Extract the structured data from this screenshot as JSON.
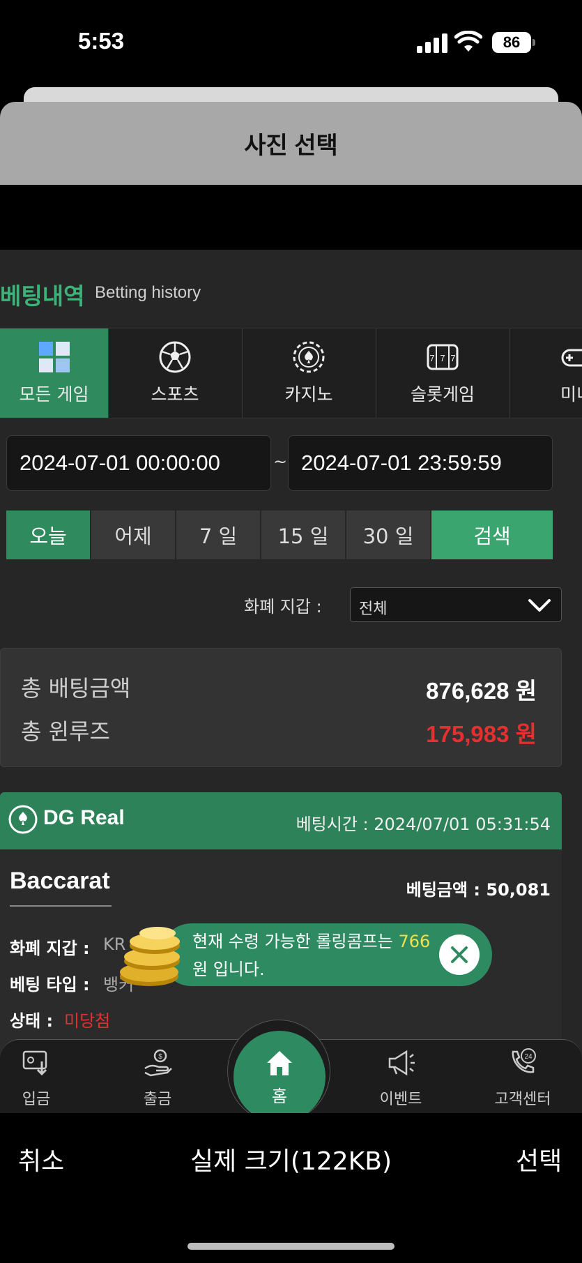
{
  "status_bar": {
    "time": "5:53",
    "battery": "86"
  },
  "sheet": {
    "title": "사진 선택"
  },
  "section": {
    "title": "베팅내역",
    "subtitle": "Betting history"
  },
  "tabs": [
    {
      "label": "모든 게임",
      "icon": "grid-cubes-icon",
      "active": true
    },
    {
      "label": "스포츠",
      "icon": "soccer-ball-icon",
      "active": false
    },
    {
      "label": "카지노",
      "icon": "poker-chip-icon",
      "active": false
    },
    {
      "label": "슬롯게임",
      "icon": "slot-777-icon",
      "active": false
    },
    {
      "label": "미니",
      "icon": "gamepad-icon",
      "active": false
    }
  ],
  "filters": {
    "date_from": "2024-07-01 00:00:00",
    "date_to": "2024-07-01 23:59:59",
    "separator": "~",
    "quick": [
      "오늘",
      "어제",
      "7 일",
      "15 일",
      "30 일"
    ],
    "quick_active": "오늘",
    "search": "검색",
    "wallet_label": "화폐 지갑 :",
    "wallet_value": "전체"
  },
  "summary": {
    "total_bet_label": "총 배팅금액",
    "total_bet_value": "876,628 원",
    "total_winloss_label": "총 윈루즈",
    "total_winloss_value": "175,983 원"
  },
  "card": {
    "provider": "DG Real",
    "bet_time": "베팅시간 : 2024/07/01 05:31:54",
    "game": "Baccarat",
    "bet_amount": "베팅금액 : 50,081",
    "rows": [
      {
        "label": "화폐 지갑 :",
        "value": "KR"
      },
      {
        "label": "베팅 타입 :",
        "value": "뱅커"
      },
      {
        "label": "상태 :",
        "value": "미당첨"
      }
    ]
  },
  "toast": {
    "line1_prefix": "현재 수령 가능한 롤링콤프는 ",
    "amount": "766",
    "line2": "원 입니다."
  },
  "nav": [
    {
      "label": "입금",
      "icon": "deposit-icon"
    },
    {
      "label": "출금",
      "icon": "withdraw-icon"
    },
    {
      "label": "홈",
      "icon": "home-icon"
    },
    {
      "label": "이벤트",
      "icon": "megaphone-icon"
    },
    {
      "label": "고객센터",
      "icon": "support-24-icon"
    }
  ],
  "picker": {
    "cancel": "취소",
    "size": "실제 크기(122KB)",
    "select": "선택"
  },
  "colors": {
    "accent": "#2f8a5e",
    "loss": "#e53030",
    "highlight": "#f2e04a"
  }
}
